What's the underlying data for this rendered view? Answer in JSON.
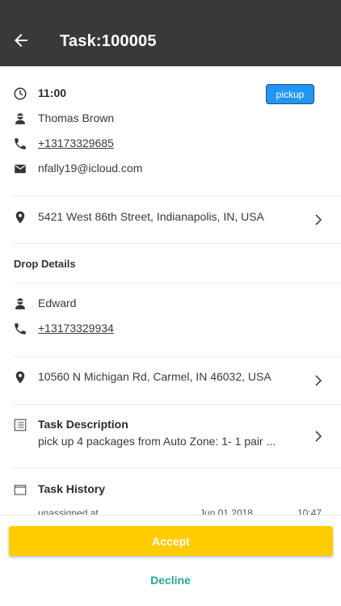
{
  "appbar": {
    "title": "Task:100005",
    "back_icon": "arrow-left-icon"
  },
  "pickup": {
    "time": "11:00",
    "badge": "pickup",
    "badge_color": "#2196f3",
    "name": "Thomas Brown",
    "phone": "+13173329685",
    "email": "nfally19@icloud.com",
    "address": "5421 West 86th Street, Indianapolis, IN, USA"
  },
  "drop": {
    "section_title": "Drop Details",
    "name": "Edward",
    "phone": "+13173329934",
    "address": "10560 N Michigan Rd, Carmel, IN 46032, USA"
  },
  "description": {
    "title": "Task Description",
    "text": "pick up 4 packages from Auto Zone: 1- 1 pair ..."
  },
  "history": {
    "title": "Task History",
    "rows": [
      {
        "status": "unassigned at",
        "date": "Jun 01 2018",
        "time": "10:47"
      }
    ]
  },
  "actions": {
    "accept": "Accept",
    "decline": "Decline",
    "accept_color": "#ffcc00",
    "decline_color": "#26a69a"
  }
}
